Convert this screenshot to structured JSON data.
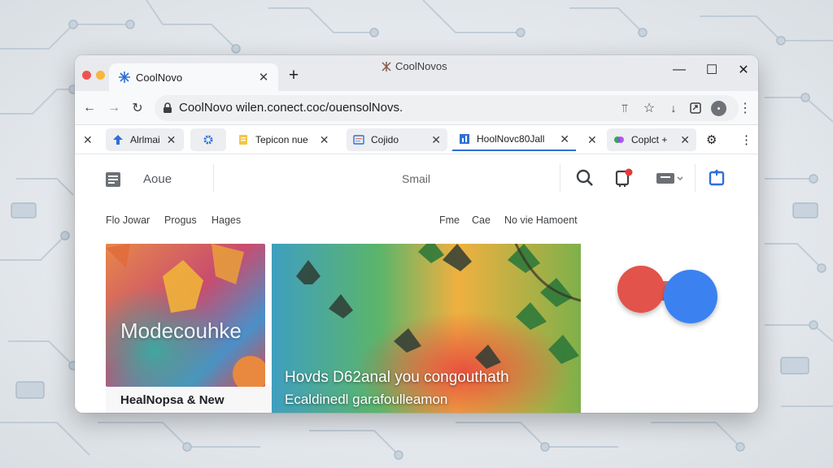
{
  "window": {
    "title": "CoolNovos",
    "active_tab": {
      "title": "CoolNovo"
    },
    "new_tab_label": "+",
    "controls": {
      "minimize": "—",
      "maximize": "☐",
      "close": "✕"
    }
  },
  "toolbar": {
    "url": "CoolNovo wilen.conect.coc/ouensolNovs.",
    "profile_initial": "•"
  },
  "tabs_row": [
    {
      "title": "",
      "kind": "close-only"
    },
    {
      "title": "Alrlmai",
      "kind": "pill"
    },
    {
      "title": "",
      "kind": "icon-only"
    },
    {
      "title": "Tepicon nue",
      "kind": "plain"
    },
    {
      "title": "Cojido",
      "kind": "pill"
    },
    {
      "title": "HoolNovc80Jall",
      "kind": "active"
    },
    {
      "title": "Coplct +",
      "kind": "pill"
    }
  ],
  "app": {
    "left_label": "Aoue",
    "center_label": "Smail",
    "subnav_left": [
      "Flo Jowar",
      "Progus",
      "Hages"
    ],
    "subnav_right": [
      "Fme",
      "Cae",
      "No vie Hamoent"
    ]
  },
  "cards": {
    "a": {
      "overlay": "Modecouhke",
      "caption": "HealNopsa & New"
    },
    "b": {
      "line1": "Hovds D62anal you congouthath",
      "line2": "Ecaldinedl garafoulleamon"
    }
  },
  "colors": {
    "accent": "#2f6fd6",
    "notify": "#e53935",
    "blob_red": "#e2534b",
    "blob_blue": "#3b82f0"
  }
}
